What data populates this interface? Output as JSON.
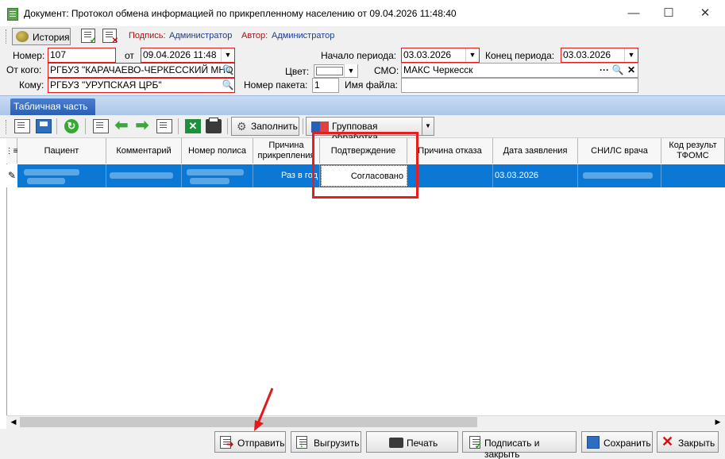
{
  "window": {
    "title": "Документ: Протокол обмена информацией по прикрепленному населению от 09.04.2026 11:48:40"
  },
  "toolbar1": {
    "history_label": "История",
    "podpis_label": "Подпись:",
    "podpis_value": "Администратор",
    "author_label": "Автор:",
    "author_value": "Администратор"
  },
  "form": {
    "nomer_label": "Номер:",
    "nomer_value": "107",
    "ot_label": "от",
    "ot_value": "09.04.2026 11:48",
    "from_label": "От кого:",
    "from_value": "РГБУЗ \"КАРАЧАЕВО-ЧЕРКЕССКИЙ МНО",
    "to_label": "Кому:",
    "to_value": "РГБУЗ \"УРУПСКАЯ ЦРБ\"",
    "start_label": "Начало периода:",
    "start_value": "03.03.2026",
    "end_label": "Конец периода:",
    "end_value": "03.03.2026",
    "color_label": "Цвет:",
    "smo_label": "СМО:",
    "smo_value": "МАКС Черкесск",
    "packet_label": "Номер пакета:",
    "packet_value": "1",
    "filename_label": "Имя файла:",
    "filename_value": ""
  },
  "tab": {
    "label": "Табличная часть"
  },
  "toolbar2": {
    "fill_label": "Заполнить",
    "group_label": "Групповая обработка"
  },
  "grid": {
    "columns": [
      "Пациент",
      "Комментарий",
      "Номер полиса",
      "Причина прикрепления",
      "Подтверждение",
      "Причина отказа",
      "Дата заявления",
      "СНИЛС врача",
      "Код результ ТФОМС"
    ],
    "row": {
      "reason": "Раз в год",
      "confirmation": "Согласовано",
      "date": "03.03.2026"
    }
  },
  "buttons": {
    "send": "Отправить",
    "export": "Выгрузить",
    "print": "Печать",
    "sign_close": "Подписать и закрыть",
    "save": "Сохранить",
    "close": "Закрыть"
  },
  "colors": {
    "selection": "#0a78d4",
    "highlight": "#e61e1e",
    "tab": "#2b5fb4"
  }
}
